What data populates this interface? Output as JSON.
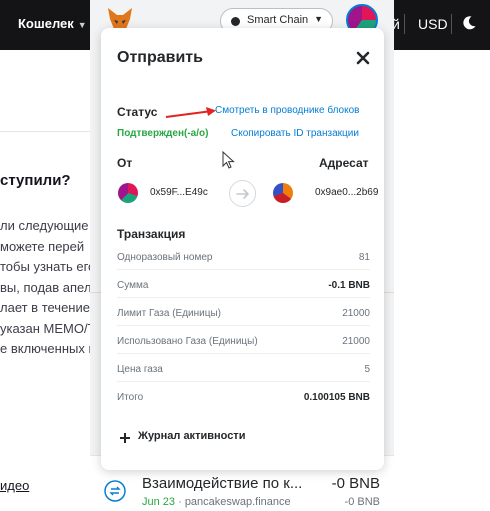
{
  "site": {
    "wallet_label": "Кошелек",
    "header_right_fragment": "й",
    "currency": "USD",
    "heading_fragment": "ступили?",
    "paragraph_lines": [
      "ли следующие",
      " можете перей",
      "тобы узнать его",
      "вы, подав апел",
      "лает в течение",
      "указан MEMO/T",
      "е включенных в"
    ],
    "video_link": "идео"
  },
  "extension": {
    "network": "Smart Chain",
    "activity": {
      "title": "Взаимодействие по к...",
      "amount": "-0 BNB",
      "date": "Jun 23",
      "source": "· pancakeswap.finance",
      "amount_sub": "-0 BNB"
    }
  },
  "modal": {
    "title": "Отправить",
    "status_label": "Статус",
    "status_value": "Подтвержден(-а/о)",
    "view_in_explorer": "Смотреть в проводнике блоков",
    "copy_tx_id": "Скопировать ID транзакции",
    "from_label": "От",
    "to_label": "Адресат",
    "from_address": "0x59F...E49c",
    "to_address": "0x9ae0...2b69",
    "transaction_heading": "Транзакция",
    "rows": [
      {
        "label": "Одноразовый номер",
        "value": "81"
      },
      {
        "label": "Сумма",
        "value": "-0.1 BNB"
      },
      {
        "label": "Лимит Газа (Единицы)",
        "value": "21000"
      },
      {
        "label": "Использовано Газа (Единицы)",
        "value": "21000"
      },
      {
        "label": "Цена газа",
        "value": "5"
      },
      {
        "label": "Итого",
        "value": "0.100105 BNB"
      }
    ],
    "activity_log": "Журнал активности"
  },
  "colors": {
    "accent_blue": "#037dd6",
    "success_green": "#28a745",
    "annotation_red": "#e32222",
    "site_header": "#141416"
  }
}
